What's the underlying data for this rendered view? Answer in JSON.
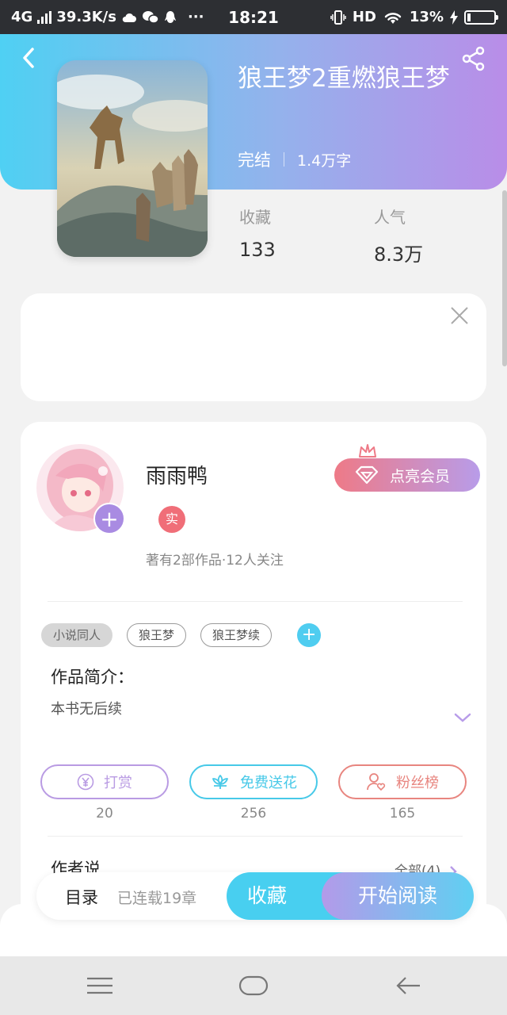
{
  "status_bar": {
    "network": "4G",
    "speed": "39.3K/s",
    "dots": "···",
    "time": "18:21",
    "hd": "HD",
    "battery": "13%"
  },
  "book": {
    "title": "狼王梦2重燃狼王梦",
    "status": "完结",
    "word_count": "1.4万字",
    "favorites_label": "收藏",
    "favorites_value": "133",
    "popularity_label": "人气",
    "popularity_value": "8.3万"
  },
  "author": {
    "name": "雨雨鸭",
    "verified_badge": "实",
    "stats": "著有2部作品·12人关注",
    "vip_button": "点亮会员"
  },
  "tags": [
    "小说同人",
    "狼王梦",
    "狼王梦续"
  ],
  "intro": {
    "heading": "作品简介：",
    "text": "本书无后续"
  },
  "actions": [
    {
      "label": "打赏",
      "count": "20",
      "color": "#b99be3"
    },
    {
      "label": "免费送花",
      "count": "256",
      "color": "#47c9e8"
    },
    {
      "label": "粉丝榜",
      "count": "165",
      "color": "#e8857f"
    }
  ],
  "author_says": {
    "heading": "作者说",
    "all_link": "全部(4)"
  },
  "bottom_bar": {
    "toc_label": "目录",
    "toc_progress": "已连载19章",
    "collect_button": "收藏",
    "read_button": "开始阅读"
  },
  "colors": {
    "accent_blue": "#48cff0",
    "accent_purple": "#b98de8",
    "accent_pink": "#ee7a87"
  }
}
